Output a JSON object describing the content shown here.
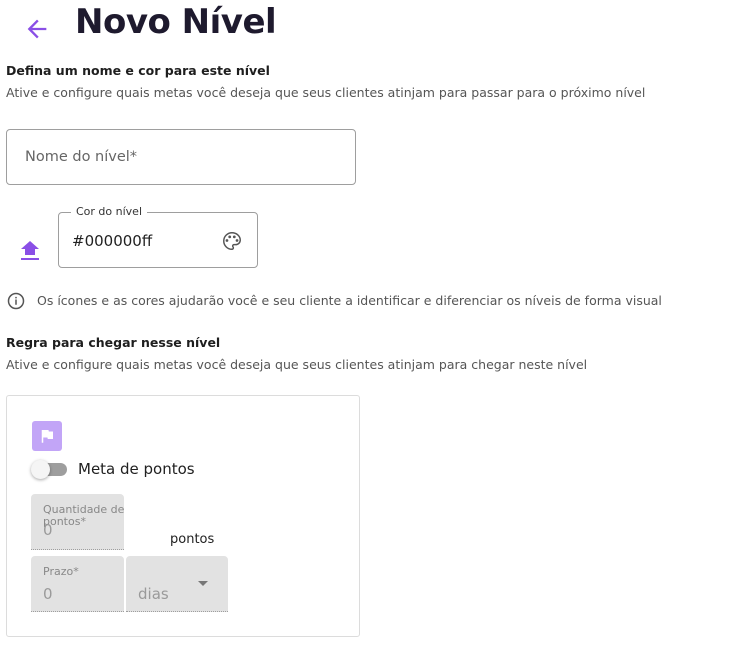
{
  "header": {
    "title": "Novo Nível",
    "back_icon": "arrow-left-icon",
    "accent": "#8a4fe6"
  },
  "level_info": {
    "title": "Defina um nome e cor para este nível",
    "subtitle": "Ative e configure quais metas você deseja que seus clientes atinjam para passar para o próximo nível",
    "name_placeholder": "Nome do nível*",
    "color_label": "Cor do nível",
    "color_value": "#000000ff",
    "upload_icon": "upload-icon",
    "palette_icon": "palette-icon"
  },
  "info": {
    "icon": "info-icon",
    "text": "Os ícones e as cores ajudarão você e seu cliente a identificar e diferenciar os níveis de forma visual"
  },
  "rule": {
    "title": "Regra para chegar nesse nível",
    "subtitle": "Ative e configure quais metas você deseja que seus clientes atinjam para chegar neste nível",
    "card": {
      "icon": "flag-icon",
      "badge_color": "#c2a5f7",
      "toggle_label": "Meta de pontos",
      "toggle_on": false,
      "quantity_label": "Quantidade de pontos*",
      "quantity_value": "0",
      "quantity_unit": "pontos",
      "deadline_label": "Prazo*",
      "deadline_value": "0",
      "deadline_unit": "dias"
    }
  }
}
